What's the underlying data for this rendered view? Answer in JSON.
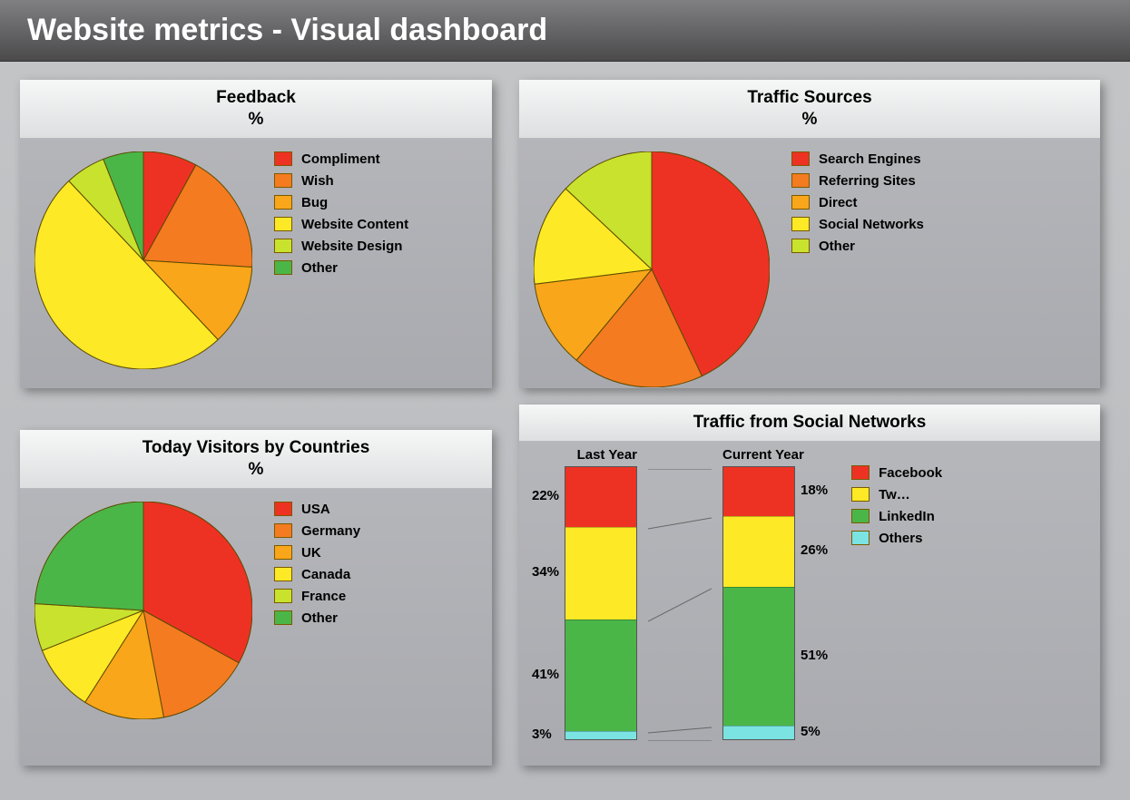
{
  "page_title": "Website metrics - Visual dashboard",
  "colors": {
    "red": "#ed3224",
    "orange": "#f47b20",
    "amber": "#f9a61a",
    "yellow": "#fde925",
    "lime": "#c8e22e",
    "green": "#4bb648",
    "cyan": "#7be3e1"
  },
  "cards": {
    "feedback": {
      "title": "Feedback",
      "sub": "%"
    },
    "visitors": {
      "title": "Today Visitors by Countries",
      "sub": "%"
    },
    "traffic": {
      "title": "Traffic Sources",
      "sub": "%"
    },
    "social": {
      "title": "Traffic from Social Networks"
    }
  },
  "chart_data": [
    {
      "id": "feedback",
      "type": "pie",
      "title": "Feedback %",
      "series": [
        {
          "name": "Compliment",
          "value": 8,
          "color": "#ed3224"
        },
        {
          "name": "Wish",
          "value": 18,
          "color": "#f47b20"
        },
        {
          "name": "Bug",
          "value": 12,
          "color": "#f9a61a"
        },
        {
          "name": "Website Content",
          "value": 50,
          "color": "#fde925"
        },
        {
          "name": "Website Design",
          "value": 6,
          "color": "#c8e22e"
        },
        {
          "name": "Other",
          "value": 6,
          "color": "#4bb648"
        }
      ]
    },
    {
      "id": "visitors",
      "type": "pie",
      "title": "Today Visitors by Countries %",
      "series": [
        {
          "name": "USA",
          "value": 33,
          "color": "#ed3224"
        },
        {
          "name": "Germany",
          "value": 14,
          "color": "#f47b20"
        },
        {
          "name": "UK",
          "value": 12,
          "color": "#f9a61a"
        },
        {
          "name": "Canada",
          "value": 10,
          "color": "#fde925"
        },
        {
          "name": "France",
          "value": 7,
          "color": "#c8e22e"
        },
        {
          "name": "Other",
          "value": 24,
          "color": "#4bb648"
        }
      ]
    },
    {
      "id": "traffic",
      "type": "pie",
      "title": "Traffic Sources %",
      "series": [
        {
          "name": "Search Engines",
          "value": 43,
          "color": "#ed3224"
        },
        {
          "name": "Referring Sites",
          "value": 18,
          "color": "#f47b20"
        },
        {
          "name": "Direct",
          "value": 12,
          "color": "#f9a61a"
        },
        {
          "name": "Social Networks",
          "value": 14,
          "color": "#fde925"
        },
        {
          "name": "Other",
          "value": 13,
          "color": "#c8e22e"
        }
      ]
    },
    {
      "id": "social",
      "type": "stacked-bar",
      "title": "Traffic from Social Networks",
      "categories": [
        "Last Year",
        "Current Year"
      ],
      "series": [
        {
          "name": "Facebook",
          "color": "#ed3224",
          "values": [
            22,
            18
          ]
        },
        {
          "name": "Tw…",
          "color": "#fde925",
          "values": [
            34,
            26
          ]
        },
        {
          "name": "LinkedIn",
          "color": "#4bb648",
          "values": [
            41,
            51
          ]
        },
        {
          "name": "Others",
          "color": "#7be3e1",
          "values": [
            3,
            5
          ]
        }
      ],
      "bar_labels": {
        "left": [
          "22%",
          "34%",
          "41%",
          "3%"
        ],
        "right": [
          "18%",
          "26%",
          "51%",
          "5%"
        ]
      }
    }
  ]
}
